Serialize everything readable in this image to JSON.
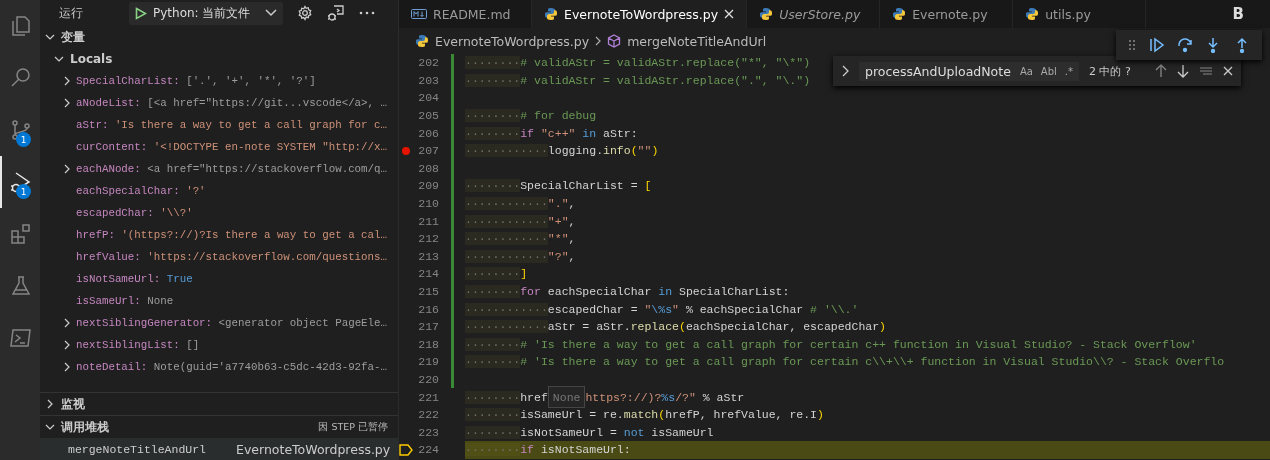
{
  "activity_bar": [
    {
      "kind": "files",
      "selected": false
    },
    {
      "kind": "search",
      "selected": false
    },
    {
      "kind": "source_control",
      "selected": false,
      "badge": "1"
    },
    {
      "kind": "run_debug",
      "selected": true,
      "badge": "1"
    },
    {
      "kind": "extensions",
      "selected": false
    },
    {
      "kind": "testing",
      "selected": false
    },
    {
      "kind": "terminal",
      "selected": false
    }
  ],
  "sidebar": {
    "title": "运行",
    "config": "Python: 当前文件",
    "sections": [
      {
        "kind": "variables",
        "label": "变量",
        "expanded": true,
        "scope": {
          "label": "Locals",
          "expanded": true,
          "items": [
            {
              "name": "SpecialCharList:",
              "value": "['.', '+', '*', '?']",
              "kind": "plain",
              "expandable": true
            },
            {
              "name": "aNodeList:",
              "value": "[<a href=\"https://git...vscode</a>, …",
              "kind": "plain",
              "expandable": true
            },
            {
              "name": "aStr:",
              "value": "'Is there a way to get a call graph for c…",
              "kind": "string",
              "expandable": false
            },
            {
              "name": "curContent:",
              "value": "'<!DOCTYPE en-note SYSTEM \"http://x…",
              "kind": "string",
              "expandable": false
            },
            {
              "name": "eachANode:",
              "value": "<a href=\"https://stackoverflow.com/q…",
              "kind": "plain",
              "expandable": true
            },
            {
              "name": "eachSpecialChar:",
              "value": "'?'",
              "kind": "string",
              "expandable": false
            },
            {
              "name": "escapedChar:",
              "value": "'\\\\?'",
              "kind": "string",
              "expandable": false
            },
            {
              "name": "hrefP:",
              "value": "'(https?://)?Is there a way to get a cal…",
              "kind": "string",
              "expandable": false
            },
            {
              "name": "hrefValue:",
              "value": "'https://stackoverflow.com/questions…",
              "kind": "string",
              "expandable": false
            },
            {
              "name": "isNotSameUrl:",
              "value": "True",
              "kind": "bool",
              "expandable": false
            },
            {
              "name": "isSameUrl:",
              "value": "None",
              "kind": "plain",
              "expandable": false
            },
            {
              "name": "nextSiblingGenerator:",
              "value": "<generator object PageEle…",
              "kind": "plain",
              "expandable": true
            },
            {
              "name": "nextSiblingList:",
              "value": "[]",
              "kind": "plain",
              "expandable": true
            },
            {
              "name": "noteDetail:",
              "value": "Note(guid='a7740b63-c5dc-42d3-92fa-…",
              "kind": "plain",
              "expandable": true
            }
          ]
        }
      },
      {
        "kind": "watch",
        "label": "监视",
        "expanded": false
      },
      {
        "kind": "call_stack",
        "label": "调用堆栈",
        "expanded": true,
        "status": "因 STEP 已暂停",
        "frames": [
          {
            "function": "mergeNoteTitleAndUrl",
            "file": "EvernoteToWordpress.py",
            "selected": true
          }
        ]
      }
    ]
  },
  "tabs": [
    {
      "label": "README.md",
      "kind": "markdown",
      "selected": false,
      "preview": false
    },
    {
      "label": "EvernoteToWordpress.py",
      "kind": "python",
      "selected": true,
      "preview": false
    },
    {
      "label": "UserStore.py",
      "kind": "python",
      "selected": false,
      "preview": true
    },
    {
      "label": "Evernote.py",
      "kind": "python",
      "selected": false,
      "preview": false
    },
    {
      "label": "utils.py",
      "kind": "python",
      "selected": false,
      "preview": false
    }
  ],
  "tab_actions": [
    "B"
  ],
  "breadcrumb": {
    "file": "EvernoteToWordpress.py",
    "symbol": "mergeNoteTitleAndUrl"
  },
  "find_widget": {
    "value": "processAndUploadNote",
    "options": [
      "Aa",
      "Abl",
      ".*"
    ],
    "result": "2 中的 ?"
  },
  "code": [
    {
      "number": "202",
      "modified": true,
      "breakpoint": false,
      "current": false,
      "tokens": [
        {
          "kind": "ws",
          "t": "········"
        },
        {
          "kind": "cmt",
          "t": "# validAStr = validAStr.replace(\"*\", \"\\*\")"
        }
      ]
    },
    {
      "number": "203",
      "modified": true,
      "breakpoint": false,
      "current": false,
      "tokens": [
        {
          "kind": "ws",
          "t": "········"
        },
        {
          "kind": "cmt",
          "t": "# validAStr = validAStr.replace(\".\", \"\\.\")"
        }
      ]
    },
    {
      "number": "204",
      "modified": true,
      "breakpoint": false,
      "current": false
    },
    {
      "number": "205",
      "modified": true,
      "breakpoint": false,
      "current": false,
      "tokens": [
        {
          "kind": "ws",
          "t": "········"
        },
        {
          "kind": "cmt",
          "t": "# for debug"
        }
      ]
    },
    {
      "number": "206",
      "modified": true,
      "breakpoint": false,
      "current": false,
      "tokens": [
        {
          "kind": "ws",
          "t": "········"
        },
        {
          "kind": "kw",
          "t": "if"
        },
        {
          "kind": "str",
          "t": " \"c++\""
        },
        {
          "kind": "op",
          "t": " in"
        },
        {
          "kind": "tx",
          "t": " aStr:"
        }
      ]
    },
    {
      "number": "207",
      "modified": true,
      "breakpoint": true,
      "current": false,
      "tokens": [
        {
          "kind": "ws",
          "t": "············"
        },
        {
          "kind": "tx",
          "t": "logging."
        },
        {
          "kind": "fn",
          "t": "info"
        },
        {
          "kind": "br",
          "t": "("
        },
        {
          "kind": "str",
          "t": "\"\""
        },
        {
          "kind": "br",
          "t": ")"
        }
      ]
    },
    {
      "number": "208",
      "modified": true,
      "breakpoint": false,
      "current": false
    },
    {
      "number": "209",
      "modified": true,
      "breakpoint": false,
      "current": false,
      "tokens": [
        {
          "kind": "ws",
          "t": "········"
        },
        {
          "kind": "tx",
          "t": "SpecialCharList = "
        },
        {
          "kind": "br",
          "t": "["
        }
      ]
    },
    {
      "number": "210",
      "modified": true,
      "breakpoint": false,
      "current": false,
      "tokens": [
        {
          "kind": "ws",
          "t": "············"
        },
        {
          "kind": "str",
          "t": "\".\""
        },
        {
          "kind": "tx",
          "t": ","
        }
      ]
    },
    {
      "number": "211",
      "modified": true,
      "breakpoint": false,
      "current": false,
      "tokens": [
        {
          "kind": "ws",
          "t": "············"
        },
        {
          "kind": "str",
          "t": "\"+\""
        },
        {
          "kind": "tx",
          "t": ","
        }
      ]
    },
    {
      "number": "212",
      "modified": true,
      "breakpoint": false,
      "current": false,
      "tokens": [
        {
          "kind": "ws",
          "t": "············"
        },
        {
          "kind": "str",
          "t": "\"*\""
        },
        {
          "kind": "tx",
          "t": ","
        }
      ]
    },
    {
      "number": "213",
      "modified": true,
      "breakpoint": false,
      "current": false,
      "tokens": [
        {
          "kind": "ws",
          "t": "············"
        },
        {
          "kind": "str",
          "t": "\"?\""
        },
        {
          "kind": "tx",
          "t": ","
        }
      ]
    },
    {
      "number": "214",
      "modified": true,
      "breakpoint": false,
      "current": false,
      "tokens": [
        {
          "kind": "ws",
          "t": "········"
        },
        {
          "kind": "br",
          "t": "]"
        }
      ]
    },
    {
      "number": "215",
      "modified": true,
      "breakpoint": false,
      "current": false,
      "tokens": [
        {
          "kind": "ws",
          "t": "········"
        },
        {
          "kind": "kw",
          "t": "for"
        },
        {
          "kind": "tx",
          "t": " eachSpecialChar "
        },
        {
          "kind": "op",
          "t": "in"
        },
        {
          "kind": "tx",
          "t": " SpecialCharList:"
        }
      ]
    },
    {
      "number": "216",
      "modified": true,
      "breakpoint": false,
      "current": false,
      "tokens": [
        {
          "kind": "ws",
          "t": "············"
        },
        {
          "kind": "tx",
          "t": "escapedChar = "
        },
        {
          "kind": "str",
          "t": "\""
        },
        {
          "kind": "esc",
          "t": "\\%s"
        },
        {
          "kind": "str",
          "t": "\""
        },
        {
          "kind": "tx",
          "t": " % eachSpecialChar "
        },
        {
          "kind": "cmt",
          "t": "# '\\\\.'"
        }
      ]
    },
    {
      "number": "217",
      "modified": true,
      "breakpoint": false,
      "current": false,
      "tokens": [
        {
          "kind": "ws",
          "t": "············"
        },
        {
          "kind": "tx",
          "t": "aStr = aStr."
        },
        {
          "kind": "fn",
          "t": "replace"
        },
        {
          "kind": "br",
          "t": "("
        },
        {
          "kind": "tx",
          "t": "eachSpecialChar, escapedChar"
        },
        {
          "kind": "br",
          "t": ")"
        }
      ]
    },
    {
      "number": "218",
      "modified": true,
      "breakpoint": false,
      "current": false,
      "tokens": [
        {
          "kind": "ws",
          "t": "········"
        },
        {
          "kind": "cmt",
          "t": "# 'Is there a way to get a call graph for certain c++ function in Visual Studio? - Stack Overflow'"
        }
      ]
    },
    {
      "number": "219",
      "modified": true,
      "breakpoint": false,
      "current": false,
      "tokens": [
        {
          "kind": "ws",
          "t": "········"
        },
        {
          "kind": "cmt",
          "t": "# 'Is there a way to get a call graph for certain c\\\\+\\\\+ function in Visual Studio\\\\? - Stack Overflo"
        }
      ]
    },
    {
      "number": "220",
      "modified": true,
      "breakpoint": false,
      "current": false
    },
    {
      "number": "221",
      "modified": false,
      "breakpoint": false,
      "current": false,
      "tokens": [
        {
          "kind": "ws",
          "t": "········"
        },
        {
          "kind": "tx",
          "t": "href"
        },
        {
          "kind": "hover",
          "t": "None"
        },
        {
          "kind": "str",
          "t": "https?://)?"
        },
        {
          "kind": "esc",
          "t": "%s"
        },
        {
          "kind": "str",
          "t": "/?\""
        },
        {
          "kind": "tx",
          "t": " % aStr"
        }
      ]
    },
    {
      "number": "222",
      "modified": false,
      "breakpoint": false,
      "current": false,
      "tokens": [
        {
          "kind": "ws",
          "t": "········"
        },
        {
          "kind": "tx",
          "t": "isSameUrl = re."
        },
        {
          "kind": "fn",
          "t": "match"
        },
        {
          "kind": "br",
          "t": "("
        },
        {
          "kind": "tx",
          "t": "hrefP, hrefValue, re.I"
        },
        {
          "kind": "br",
          "t": ")"
        }
      ]
    },
    {
      "number": "223",
      "modified": false,
      "breakpoint": false,
      "current": false,
      "tokens": [
        {
          "kind": "ws",
          "t": "········"
        },
        {
          "kind": "tx",
          "t": "isNotSameUrl = "
        },
        {
          "kind": "op",
          "t": "not"
        },
        {
          "kind": "tx",
          "t": " isSameUrl"
        }
      ]
    },
    {
      "number": "224",
      "modified": false,
      "breakpoint": false,
      "current": true,
      "tokens": [
        {
          "kind": "ws",
          "t": "········"
        },
        {
          "kind": "kw",
          "t": "if"
        },
        {
          "kind": "tx",
          "t": " isNotSameUrl:"
        }
      ]
    }
  ]
}
